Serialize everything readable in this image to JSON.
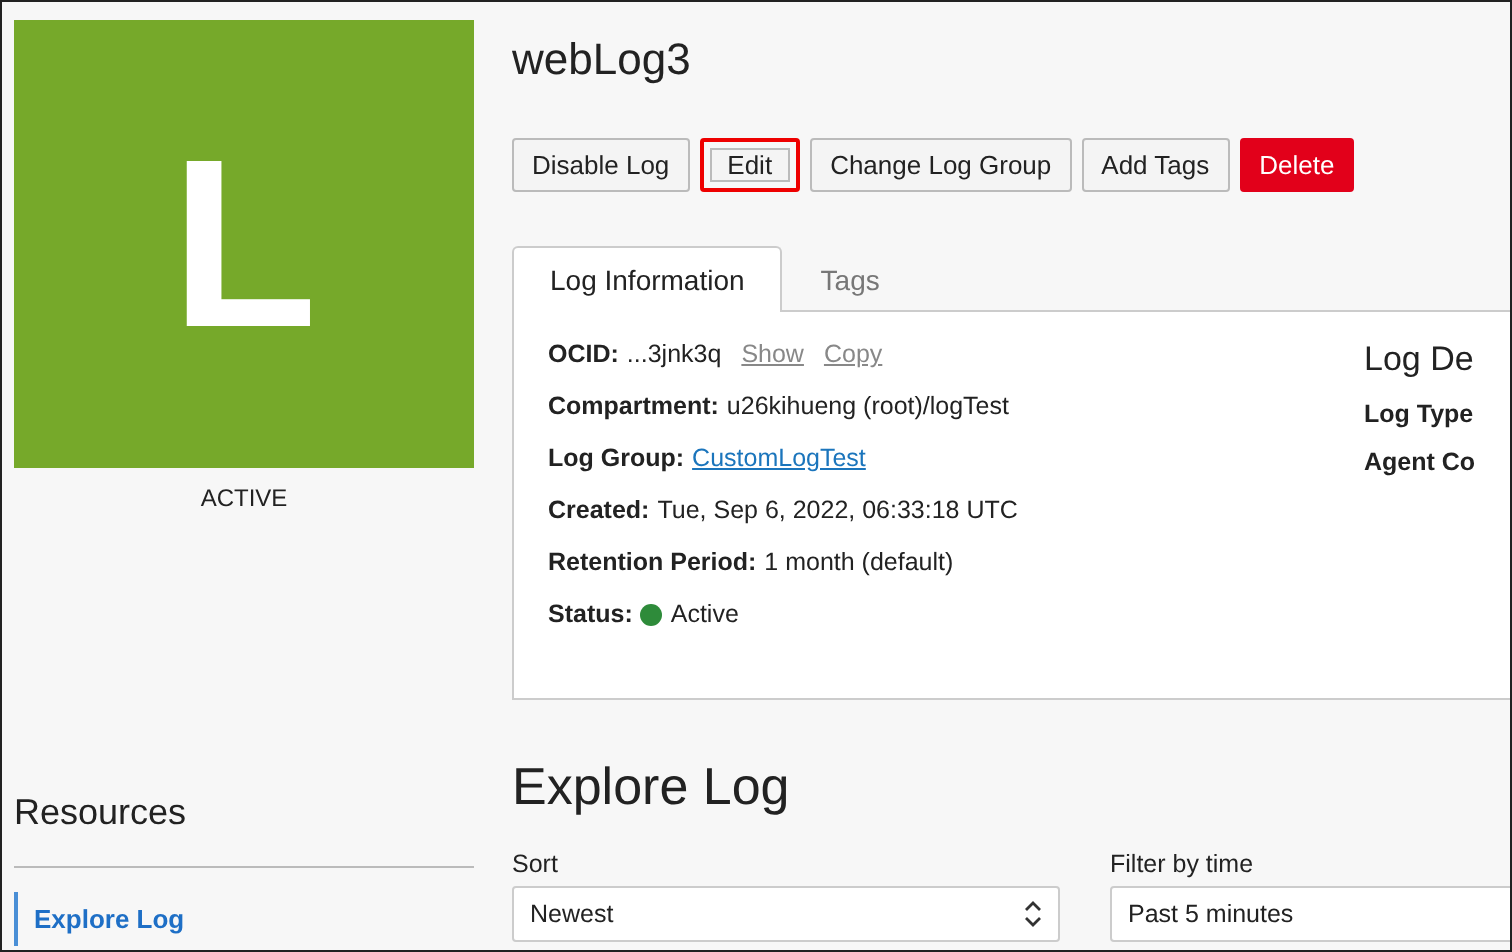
{
  "resource": {
    "letter": "L",
    "color": "#76a92a",
    "status": "ACTIVE"
  },
  "title": "webLog3",
  "actions": [
    {
      "label": "Disable Log",
      "kind": "default",
      "highlighted": false
    },
    {
      "label": "Edit",
      "kind": "default",
      "highlighted": true
    },
    {
      "label": "Change Log Group",
      "kind": "default",
      "highlighted": false
    },
    {
      "label": "Add Tags",
      "kind": "default",
      "highlighted": false
    },
    {
      "label": "Delete",
      "kind": "danger",
      "highlighted": false
    }
  ],
  "tabs": [
    {
      "label": "Log Information",
      "selected": true
    },
    {
      "label": "Tags",
      "selected": false
    }
  ],
  "info": {
    "ocid": {
      "label": "OCID:",
      "value": "...3jnk3q",
      "links": [
        "Show",
        "Copy"
      ]
    },
    "fields": [
      {
        "label": "Compartment:",
        "value": "u26kihueng (root)/logTest",
        "kind": "text"
      },
      {
        "label": "Log Group:",
        "value": "CustomLogTest",
        "kind": "link"
      },
      {
        "label": "Created:",
        "value": "Tue, Sep 6, 2022, 06:33:18 UTC",
        "kind": "text"
      },
      {
        "label": "Retention Period:",
        "value": "1 month (default)",
        "kind": "text"
      }
    ],
    "status": {
      "label": "Status:",
      "value": "Active",
      "color": "#2e8b3a"
    },
    "side_heading": "Log De",
    "side_labels": [
      "Log Type",
      "Agent Co"
    ]
  },
  "resources": {
    "heading": "Resources",
    "items": [
      {
        "label": "Explore Log",
        "selected": true
      }
    ]
  },
  "explore": {
    "heading": "Explore Log",
    "sort": {
      "label": "Sort",
      "value": "Newest"
    },
    "filter": {
      "label": "Filter by time",
      "value": "Past 5 minutes"
    }
  }
}
